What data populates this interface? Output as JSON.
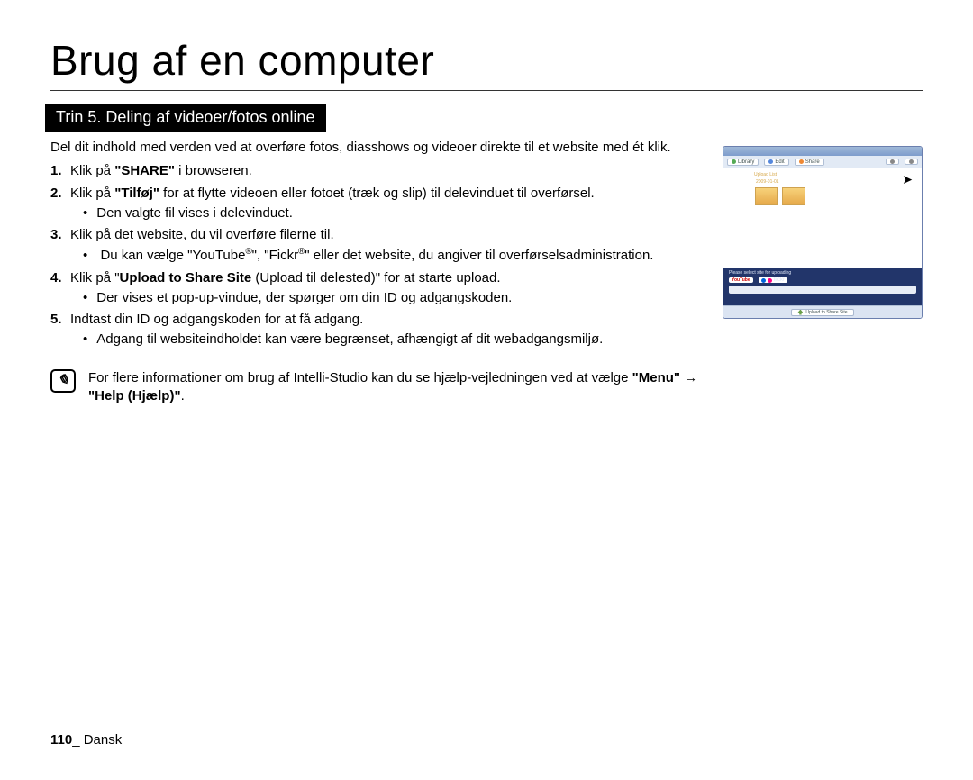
{
  "title": "Brug af en computer",
  "section_bar": "Trin 5. Deling af videoer/fotos online",
  "intro": "Del dit indhold med verden ved at overføre fotos, diasshows og videoer direkte til et website med ét klik.",
  "steps": {
    "s1": {
      "n": "1.",
      "pre": "Klik på ",
      "bold": "\"SHARE\"",
      "post": " i browseren."
    },
    "s2": {
      "n": "2.",
      "pre": "Klik på ",
      "bold": "\"Tilføj\"",
      "post": " for at flytte videoen eller fotoet (træk og slip) til delevinduet til overførsel.",
      "sub": "Den valgte fil vises i delevinduet."
    },
    "s3": {
      "n": "3.",
      "text": "Klik på det website, du vil overføre filerne til.",
      "sub_pre": "Du kan vælge \"YouTube",
      "sub_mid": "\", \"Fickr",
      "sub_post": "\" eller det website, du angiver til overførselsadministration."
    },
    "s4": {
      "n": "4.",
      "pre": "Klik på \"",
      "bold": "Upload to Share Site",
      "post": " (Upload til delested)\" for at starte upload.",
      "sub": "Der vises et pop-up-vindue, der spørger om din ID og adgangskoden."
    },
    "s5": {
      "n": "5.",
      "text": "Indtast din ID og adgangskoden for at få adgang.",
      "sub": "Adgang til websiteindholdet kan være begrænset, afhængigt af dit webadgangsmiljø."
    }
  },
  "note": {
    "pre": "For flere informationer om brug af Intelli-Studio kan du se hjælp-vejledningen ved at vælge ",
    "b1": "\"Menu\"",
    "arrow": " → ",
    "b2": "\"Help (Hjælp)\"",
    "post": "."
  },
  "footer": {
    "page": "110",
    "sep": "_ ",
    "lang": "Dansk"
  },
  "thumb": {
    "tabs": {
      "a": "Library",
      "b": "Edit",
      "c": "Share"
    },
    "canvas_label": "Upload List",
    "date": "2009-01-01",
    "lower_label": "Please select site for uploading",
    "youtube": "YouTube",
    "flickr": "flickr",
    "upload": "Upload to Share Site"
  }
}
